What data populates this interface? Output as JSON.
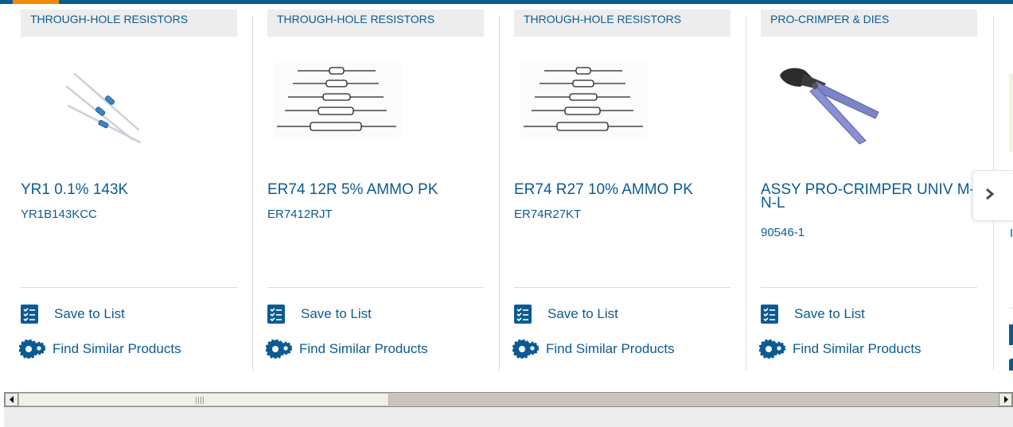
{
  "colors": {
    "accent_blue": "#0b5b93",
    "accent_orange": "#f18a00",
    "category_bg": "#ededed"
  },
  "products": [
    {
      "category": "THROUGH-HOLE RESISTORS",
      "name": "YR1 0.1% 143K",
      "part_number": "YR1B143KCC",
      "image": "resistor-photo",
      "save_label": "Save to List",
      "similar_label": "Find Similar Products"
    },
    {
      "category": "THROUGH-HOLE RESISTORS",
      "name": "ER74 12R 5% AMMO PK",
      "part_number": "ER7412RJT",
      "image": "resistor-line-drawing",
      "save_label": "Save to List",
      "similar_label": "Find Similar Products"
    },
    {
      "category": "THROUGH-HOLE RESISTORS",
      "name": "ER74 R27 10% AMMO PK",
      "part_number": "ER74R27KT",
      "image": "resistor-line-drawing",
      "save_label": "Save to List",
      "similar_label": "Find Similar Products"
    },
    {
      "category": "PRO-CRIMPER & DIES",
      "name": "ASSY PRO-CRIMPER UNIV M-N-L",
      "part_number": "90546-1",
      "image": "crimper-tool-photo",
      "save_label": "Save to List",
      "similar_label": "Find Similar Products"
    }
  ],
  "icons": {
    "save": "checklist-icon",
    "similar": "gears-icon",
    "next": "chevron-right-icon",
    "scroll_left": "arrow-left-icon",
    "scroll_right": "arrow-right-icon"
  }
}
